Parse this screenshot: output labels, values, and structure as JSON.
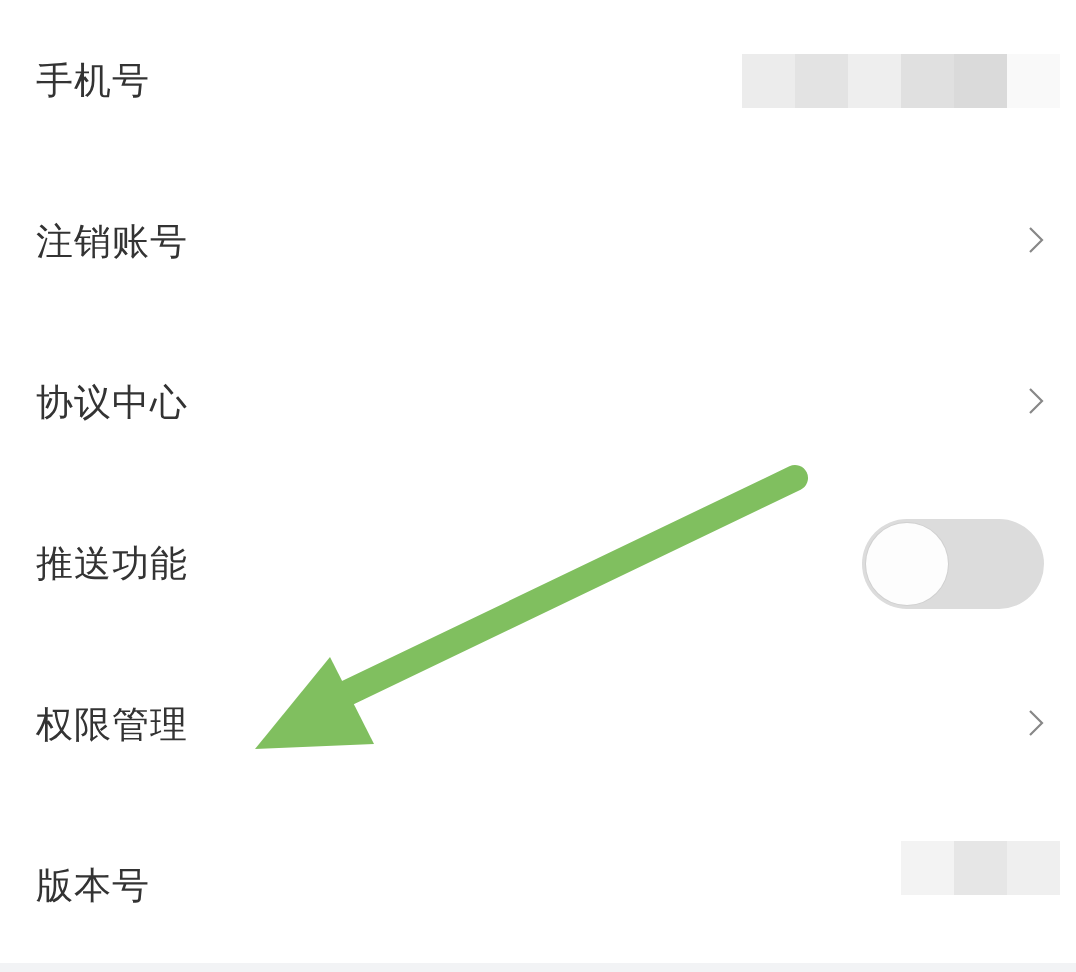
{
  "settings": [
    {
      "label": "手机号",
      "kind": "value"
    },
    {
      "label": "注销账号",
      "kind": "link"
    },
    {
      "label": "协议中心",
      "kind": "link"
    },
    {
      "label": "推送功能",
      "kind": "toggle",
      "on": false
    },
    {
      "label": "权限管理",
      "kind": "link"
    },
    {
      "label": "版本号",
      "kind": "value"
    }
  ]
}
